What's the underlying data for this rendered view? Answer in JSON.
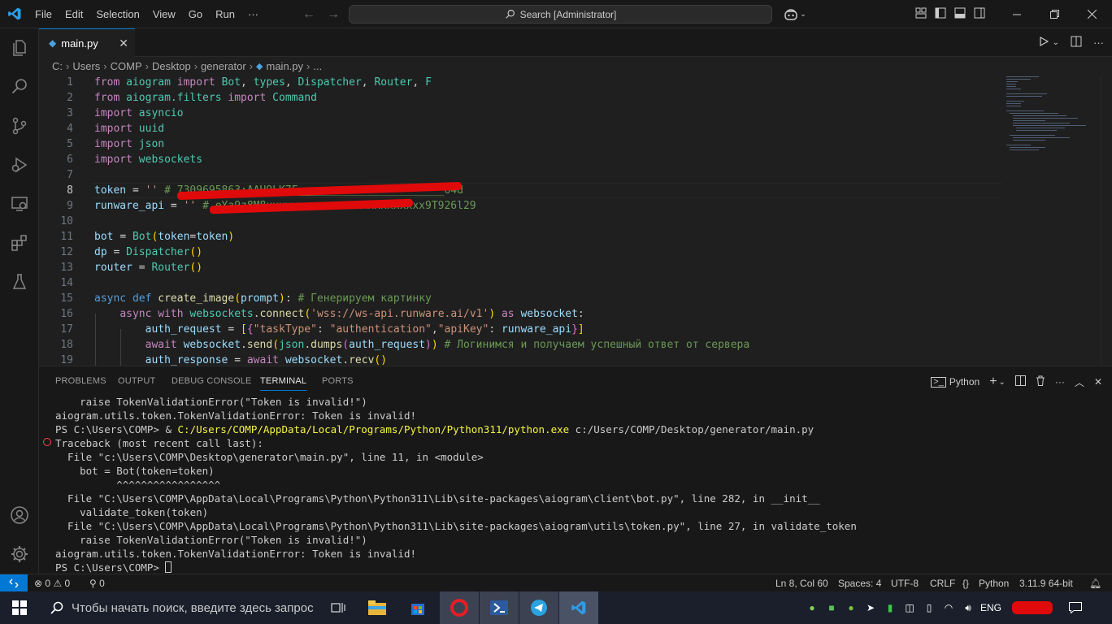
{
  "titlebar": {
    "menu": [
      "File",
      "Edit",
      "Selection",
      "View",
      "Go",
      "Run",
      "···"
    ],
    "search_text": "Search [Administrator]"
  },
  "tab": {
    "filename": "main.py"
  },
  "breadcrumb": [
    "C:",
    "Users",
    "COMP",
    "Desktop",
    "generator",
    "main.py",
    "..."
  ],
  "editor": {
    "line_numbers": [
      "1",
      "2",
      "3",
      "4",
      "5",
      "6",
      "7",
      "8",
      "9",
      "10",
      "11",
      "12",
      "13",
      "14",
      "15",
      "16",
      "17",
      "18",
      "19"
    ],
    "active_line": "8"
  },
  "panel": {
    "tabs": [
      "PROBLEMS",
      "OUTPUT",
      "DEBUG CONSOLE",
      "TERMINAL",
      "PORTS"
    ],
    "active_tab": "TERMINAL",
    "shell_label": "Python",
    "terminal_lines": [
      "    raise TokenValidationError(\"Token is invalid!\")",
      "aiogram.utils.token.TokenValidationError: Token is invalid!",
      "PS C:\\Users\\COMP> & ",
      "C:/Users/COMP/AppData/Local/Programs/Python/Python311/python.exe",
      " c:/Users/COMP/Desktop/generator/main.py",
      "Traceback (most recent call last):",
      "  File \"c:\\Users\\COMP\\Desktop\\generator\\main.py\", line 11, in <module>",
      "    bot = Bot(token=token)",
      "          ^^^^^^^^^^^^^^^^^",
      "  File \"C:\\Users\\COMP\\AppData\\Local\\Programs\\Python\\Python311\\Lib\\site-packages\\aiogram\\client\\bot.py\", line 282, in __init__",
      "    validate_token(token)",
      "  File \"C:\\Users\\COMP\\AppData\\Local\\Programs\\Python\\Python311\\Lib\\site-packages\\aiogram\\utils\\token.py\", line 27, in validate_token",
      "    raise TokenValidationError(\"Token is invalid!\")",
      "aiogram.utils.token.TokenValidationError: Token is invalid!",
      "PS C:\\Users\\COMP> "
    ]
  },
  "statusbar": {
    "errors": "0",
    "warnings": "0",
    "ports": "0",
    "position": "Ln 8, Col 60",
    "spaces": "Spaces: 4",
    "encoding": "UTF-8",
    "eol": "CRLF",
    "language": "Python",
    "interpreter": "3.11.9 64-bit"
  },
  "taskbar": {
    "search_placeholder": "Чтобы начать поиск, введите здесь запрос",
    "language": "ENG"
  },
  "colors": {
    "accent": "#0078d4",
    "keyword": "#c586c0",
    "string": "#ce9178",
    "comment": "#6a9955",
    "error": "#f14c4c"
  }
}
